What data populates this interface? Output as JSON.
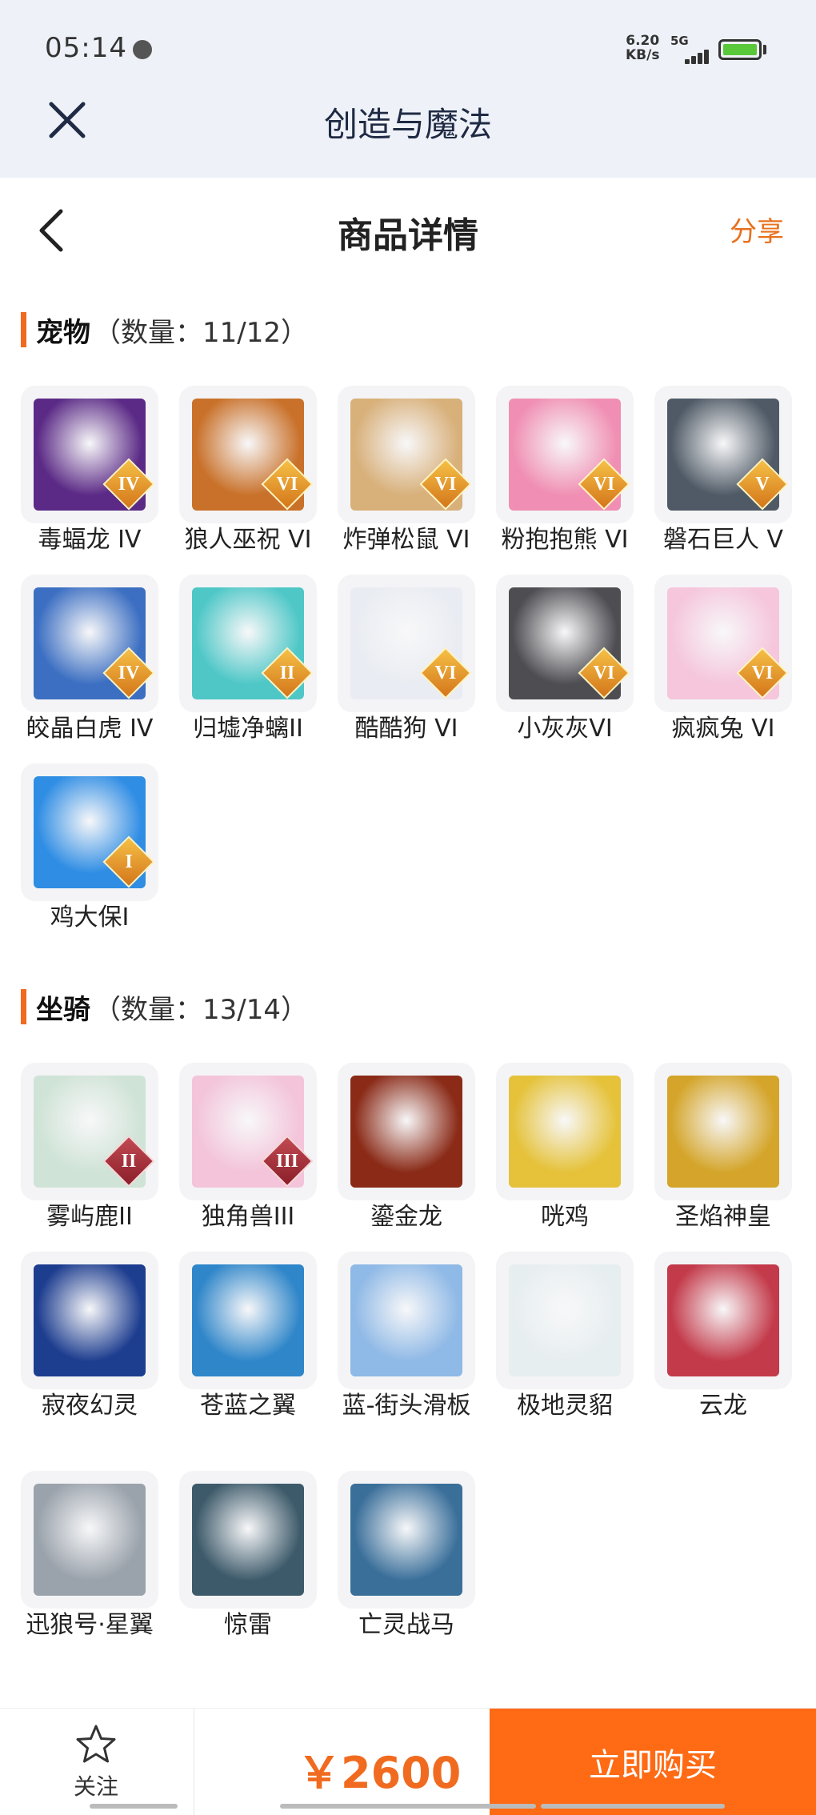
{
  "status": {
    "time": "05:14",
    "speed": "6.20",
    "speed_unit": "KB/s",
    "network": "5G"
  },
  "app": {
    "title": "创造与魔法",
    "close_icon": "close-icon"
  },
  "header": {
    "title": "商品详情",
    "share": "分享",
    "back_icon": "chevron-left-icon"
  },
  "pets": {
    "name": "宠物",
    "count": "（数量：11/12）",
    "items": [
      {
        "label": "毒蝠龙 IV",
        "badge": "IV",
        "color": "#5b2a86"
      },
      {
        "label": "狼人巫祝 VI",
        "badge": "VI",
        "color": "#c9712a"
      },
      {
        "label": "炸弹松鼠 VI",
        "badge": "VI",
        "color": "#d8b07a"
      },
      {
        "label": "粉抱抱熊 VI",
        "badge": "VI",
        "color": "#f08fb3"
      },
      {
        "label": "磐石巨人 V",
        "badge": "V",
        "color": "#4f5a66"
      },
      {
        "label": "皎晶白虎 IV",
        "badge": "IV",
        "color": "#3c6fc2"
      },
      {
        "label": "归墟净螭II",
        "badge": "II",
        "color": "#4fc7c7"
      },
      {
        "label": "酷酷狗 VI",
        "badge": "VI",
        "color": "#e9ecf2"
      },
      {
        "label": "小灰灰VI",
        "badge": "VI",
        "color": "#4d4d52"
      },
      {
        "label": "疯疯兔 VI",
        "badge": "VI",
        "color": "#f5c6dc"
      },
      {
        "label": "鸡大保I",
        "badge": "I",
        "color": "#2f8de4"
      }
    ]
  },
  "mounts": {
    "name": "坐骑",
    "count": "（数量：13/14）",
    "items": [
      {
        "label": "雾屿鹿II",
        "badge": "II",
        "color": "#cfe3d6"
      },
      {
        "label": "独角兽III",
        "badge": "III",
        "color": "#f3c4da"
      },
      {
        "label": "鎏金龙",
        "badge": "",
        "color": "#8a2a17"
      },
      {
        "label": "咣鸡",
        "badge": "",
        "color": "#e5c23a"
      },
      {
        "label": "圣焰神皇",
        "badge": "",
        "color": "#d4a52a"
      },
      {
        "label": "寂夜幻灵",
        "badge": "",
        "color": "#1d3d8f"
      },
      {
        "label": "苍蓝之翼",
        "badge": "",
        "color": "#2f86c9"
      },
      {
        "label": "蓝-街头滑板",
        "badge": "",
        "color": "#8fb9e6"
      },
      {
        "label": "极地灵貂",
        "badge": "",
        "color": "#e7eef0"
      },
      {
        "label": "云龙",
        "badge": "",
        "color": "#c33a4a"
      },
      {
        "label": "迅狼号·星翼",
        "badge": "",
        "color": "#9aa2ab"
      },
      {
        "label": "惊雷",
        "badge": "",
        "color": "#3d5a6a"
      },
      {
        "label": "亡灵战马",
        "badge": "",
        "color": "#3a6f9a"
      }
    ]
  },
  "bottom": {
    "follow": "关注",
    "price": "￥2600",
    "buy": "立即购买",
    "accent": "#ff6a14"
  }
}
